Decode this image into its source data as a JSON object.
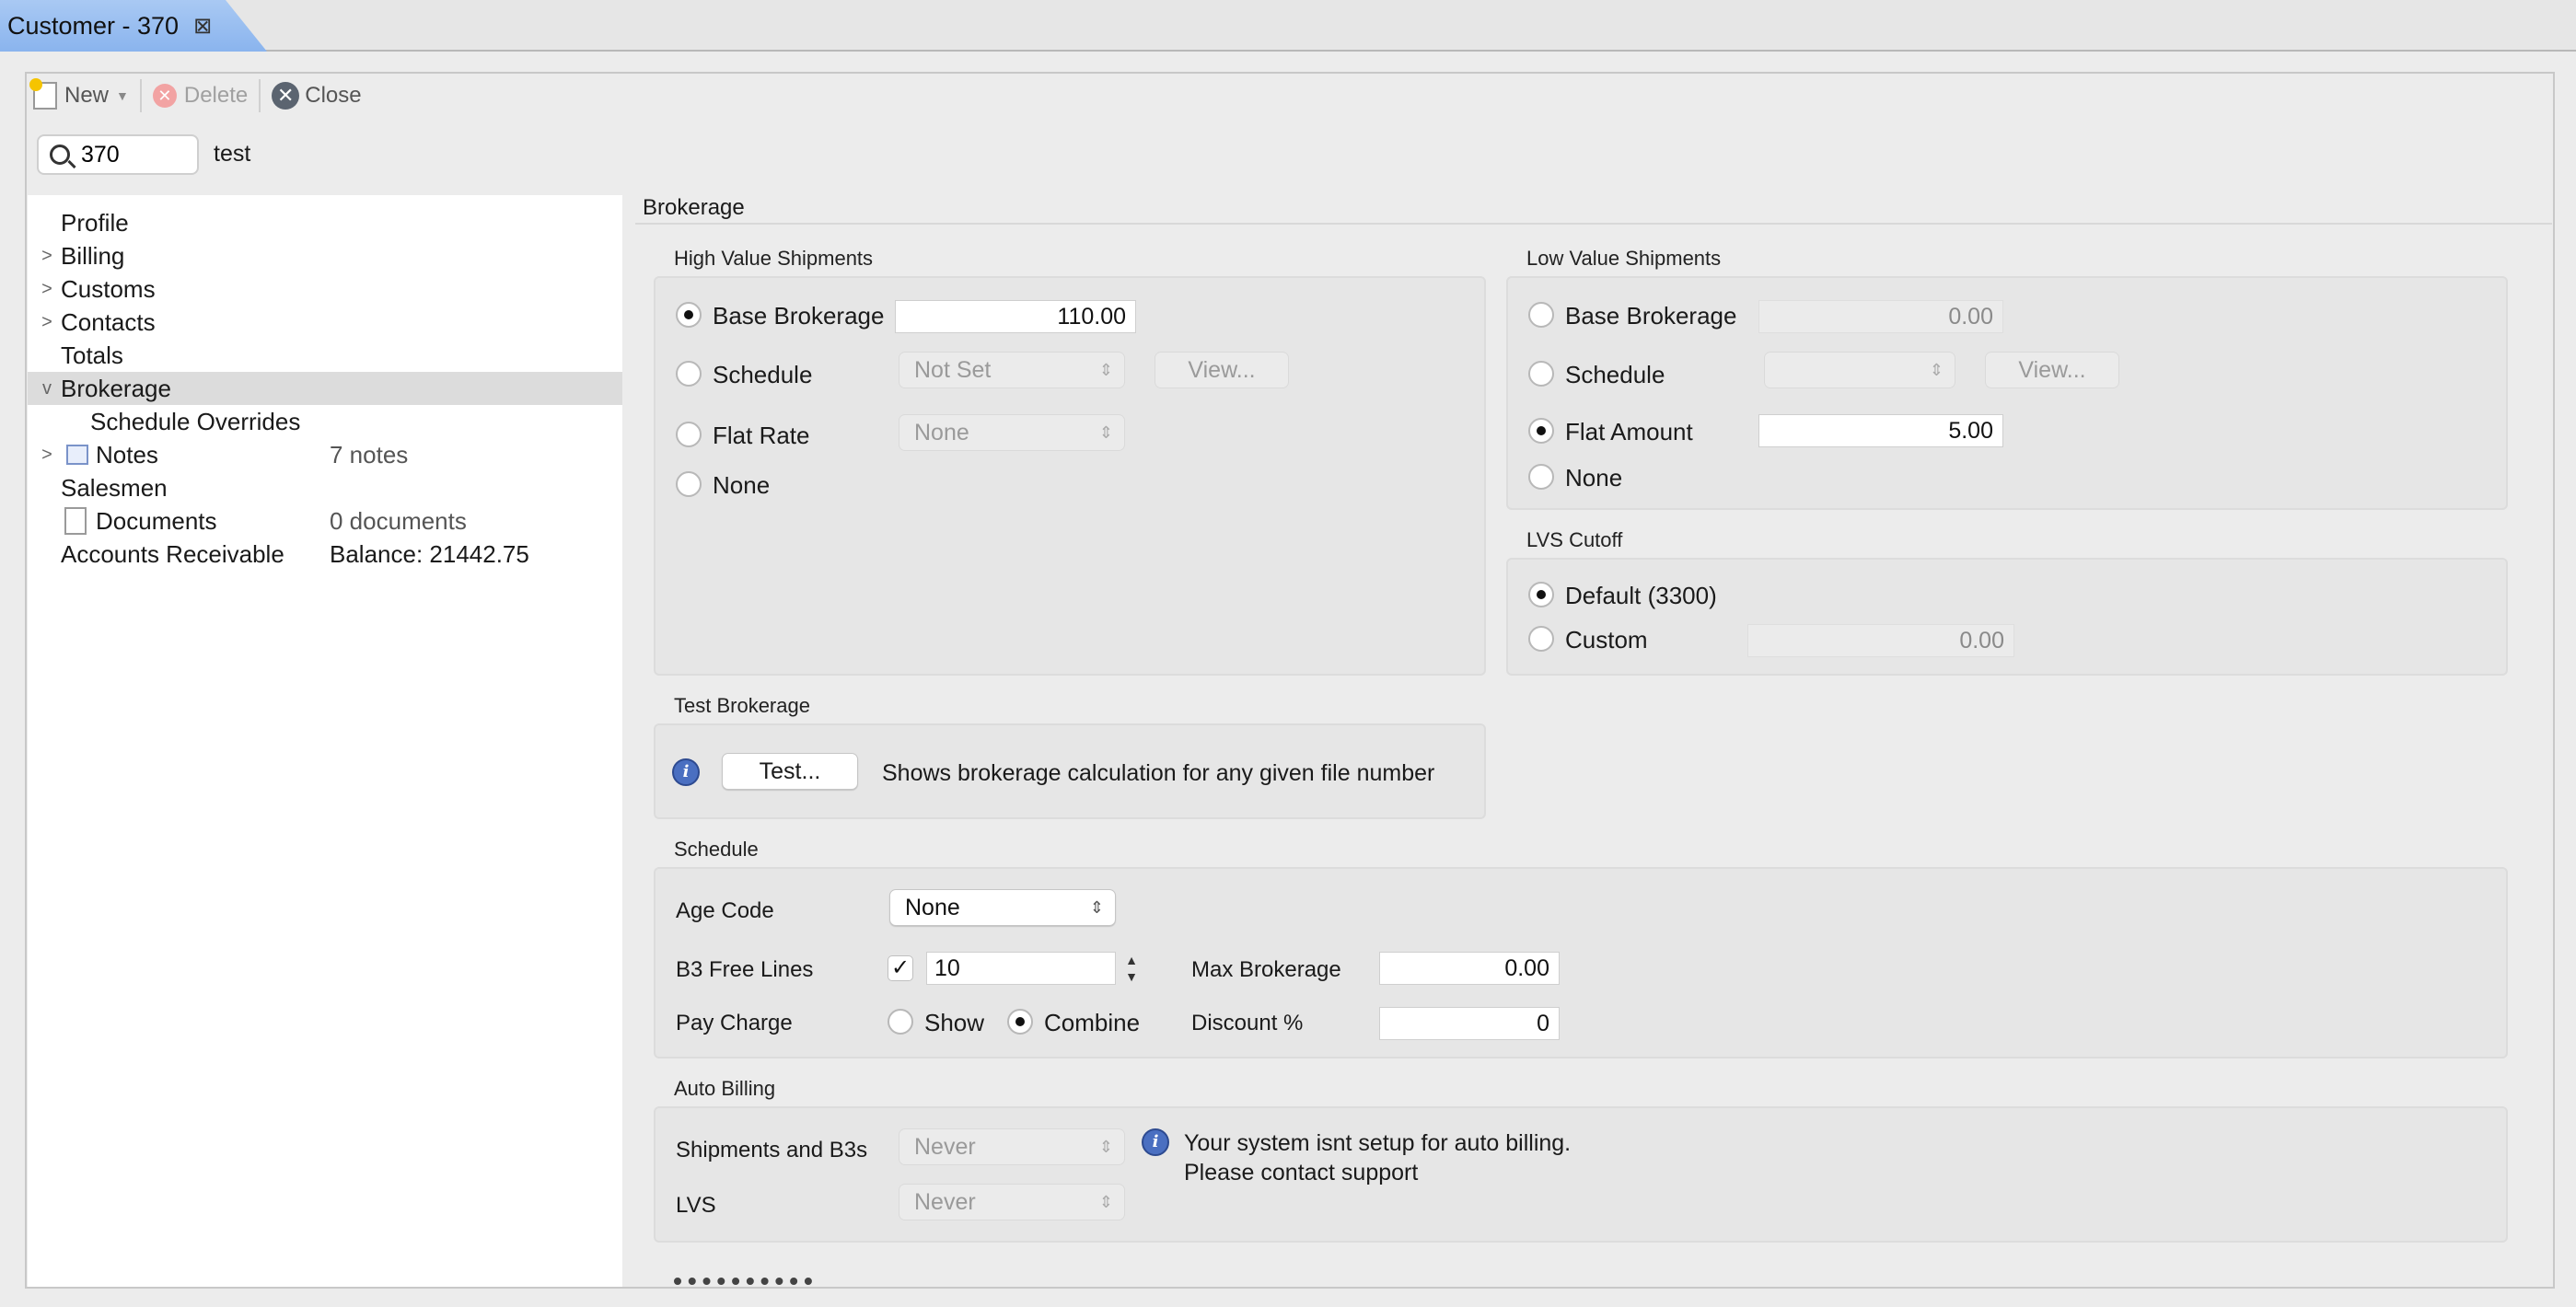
{
  "tab": {
    "title": "Customer - 370",
    "close_glyph": "⊠"
  },
  "toolbar": {
    "new_label": "New",
    "delete_label": "Delete",
    "close_label": "Close"
  },
  "search": {
    "value": "370",
    "customer_name": "test"
  },
  "tree": {
    "items": [
      {
        "label": "Profile",
        "value": ""
      },
      {
        "label": "Billing",
        "value": ""
      },
      {
        "label": "Customs",
        "value": ""
      },
      {
        "label": "Contacts",
        "value": ""
      },
      {
        "label": "Totals",
        "value": ""
      },
      {
        "label": "Brokerage",
        "value": ""
      },
      {
        "label": "Schedule Overrides",
        "value": ""
      },
      {
        "label": "Notes",
        "value": "7 notes"
      },
      {
        "label": "Salesmen",
        "value": ""
      },
      {
        "label": "Documents",
        "value": "0 documents"
      },
      {
        "label": "Accounts Receivable",
        "value": "Balance: 21442.75"
      }
    ]
  },
  "panel": {
    "title": "Brokerage"
  },
  "high_value": {
    "title": "High Value Shipments",
    "base_label": "Base Brokerage",
    "base_value": "110.00",
    "schedule_label": "Schedule",
    "schedule_select": "Not Set",
    "view_label": "View...",
    "flat_label": "Flat Rate",
    "flat_select": "None",
    "none_label": "None",
    "selected": "base"
  },
  "low_value": {
    "title": "Low Value Shipments",
    "base_label": "Base Brokerage",
    "base_value": "0.00",
    "schedule_label": "Schedule",
    "schedule_select": "",
    "view_label": "View...",
    "flat_label": "Flat Amount",
    "flat_value": "5.00",
    "none_label": "None",
    "selected": "flat"
  },
  "lvs_cutoff": {
    "title": "LVS Cutoff",
    "default_label": "Default (3300)",
    "custom_label": "Custom",
    "custom_value": "0.00",
    "selected": "default"
  },
  "test_brokerage": {
    "title": "Test Brokerage",
    "button_label": "Test...",
    "description": "Shows brokerage calculation for any given file number"
  },
  "schedule": {
    "title": "Schedule",
    "age_code_label": "Age Code",
    "age_code_value": "None",
    "b3_free_lines_label": "B3 Free Lines",
    "b3_free_lines_checked": true,
    "b3_free_lines_value": "10",
    "max_brokerage_label": "Max Brokerage",
    "max_brokerage_value": "0.00",
    "pay_charge_label": "Pay Charge",
    "show_label": "Show",
    "combine_label": "Combine",
    "pay_charge_selected": "combine",
    "discount_label": "Discount %",
    "discount_value": "0"
  },
  "auto_billing": {
    "title": "Auto Billing",
    "shipments_label": "Shipments and B3s",
    "shipments_value": "Never",
    "lvs_label": "LVS",
    "lvs_value": "Never",
    "message_line1": "Your system isnt setup for auto billing.",
    "message_line2": "Please contact support"
  },
  "colors": {
    "tab_active": "#8ab4ee",
    "tree_selected": "#dcdcdc",
    "info_icon": "#4a6fc1"
  }
}
